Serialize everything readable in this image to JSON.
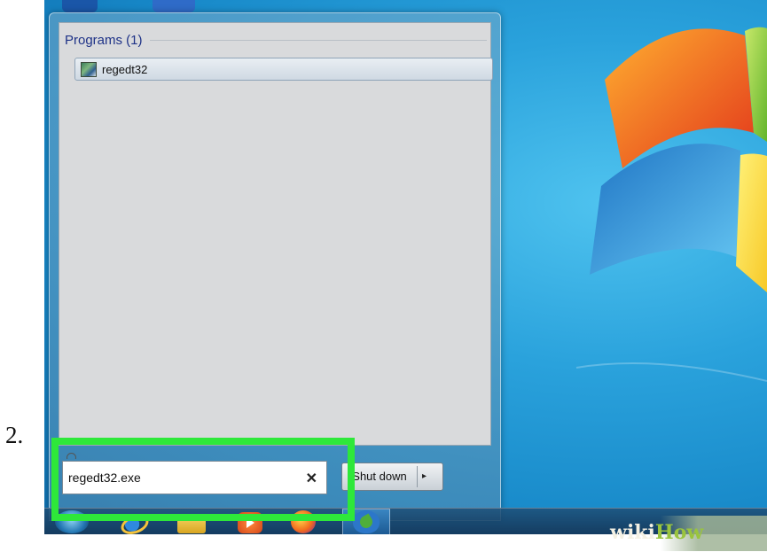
{
  "step": {
    "number": "2."
  },
  "start_menu": {
    "group_header": "Programs (1)",
    "results": [
      {
        "label": "regedt32",
        "icon": "registry-editor-icon"
      }
    ],
    "search": {
      "value": "regedt32.exe",
      "clear_glyph": "✕"
    },
    "shutdown": {
      "label": "Shut down",
      "arrow": "▸"
    }
  },
  "taskbar": {
    "icons": [
      "start-orb-icon",
      "internet-explorer-icon",
      "file-explorer-icon",
      "media-player-icon",
      "firefox-icon",
      "malwarebytes-icon"
    ]
  },
  "watermark": {
    "text_a": "wiki",
    "text_b": "How"
  },
  "colors": {
    "highlight": "#2ee83a",
    "desktop": "#2aa2dc",
    "header_text": "#1e3287"
  }
}
